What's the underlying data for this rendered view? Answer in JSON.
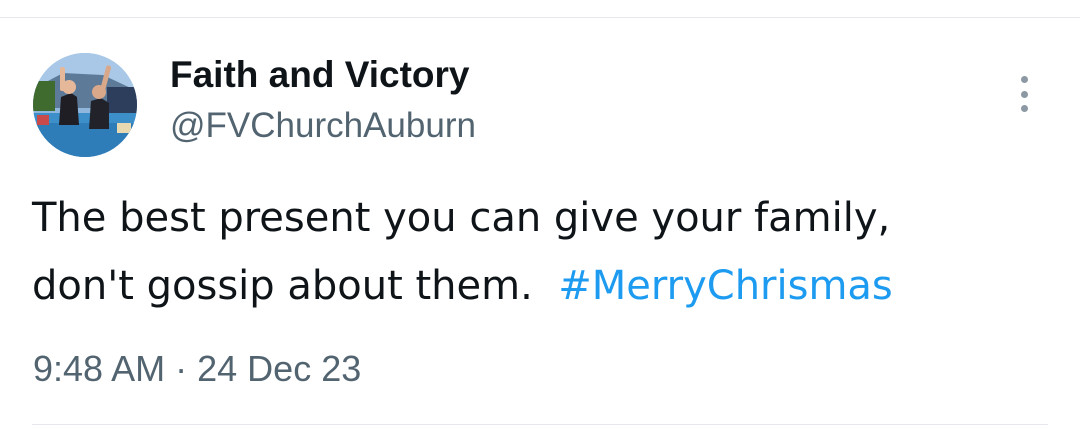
{
  "tweet": {
    "author": {
      "display_name": "Faith and Victory",
      "handle": "@FVChurchAuburn",
      "avatar_icon": "profile-photo-avatar"
    },
    "text_main_line1": "The best present you can give your family,",
    "text_main_line2": "don't gossip about them.",
    "hashtag": "#MerryChrismas",
    "time": "9:48 AM",
    "separator": "·",
    "date": "24 Dec 23",
    "more_icon": "more-vertical-icon"
  },
  "colors": {
    "text_primary": "#0f1419",
    "text_secondary": "#536471",
    "hashtag": "#1d9bf0",
    "divider": "#e5e7ea"
  }
}
